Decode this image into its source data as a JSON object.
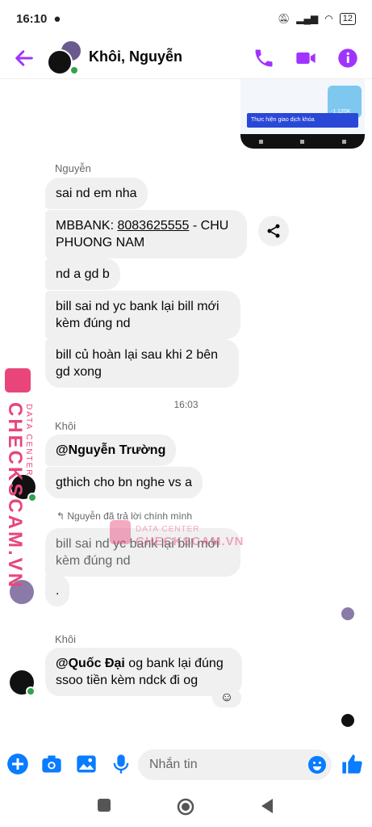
{
  "status": {
    "time": "16:10",
    "battery": "12"
  },
  "header": {
    "title": "Khôi, Nguyễn"
  },
  "colors": {
    "accent": "#a033ff",
    "bubble": "#f0f0f0",
    "blue": "#0a7cff",
    "watermark": "#e8467a"
  },
  "image_message": {
    "banner_text": "Thực hiện giao dịch khóa",
    "promo_text": "-1.120K"
  },
  "messages": {
    "sender1": "Nguyễn",
    "m1": "sai nd em nha",
    "m2a": "MBBANK: ",
    "m2b": "8083625555",
    "m2c": " -  CHU PHUONG NAM",
    "m3": "nd a gd b",
    "m4": "bill sai nd yc bank lại bill mới kèm đúng nd",
    "m5": "bill củ hoàn lại sau khi 2 bên gd xong",
    "time": "16:03",
    "sender2": "Khôi",
    "m6": "@Nguyễn Trường",
    "m7": "gthich cho bn nghe vs a",
    "reply_note": "Nguyễn đã trả lời chính mình",
    "m8": "bill sai nd yc bank lại bill mới kèm đúng nd",
    "m9": ".",
    "sender3": "Khôi",
    "m10_mention": "@Quốc Đại",
    "m10_text": "  og bank lại đúng ssoo tiền kèm ndck đi og"
  },
  "watermark": {
    "line1": "DATA CENTER",
    "line2": "CHECKSCAM.VN"
  },
  "composer": {
    "placeholder": "Nhắn tin"
  },
  "icons": [
    "back-arrow-icon",
    "phone-icon",
    "video-icon",
    "info-icon",
    "share-icon",
    "plus-icon",
    "camera-icon",
    "image-icon",
    "mic-icon",
    "emoji-icon",
    "like-icon",
    "add-reaction-icon"
  ]
}
